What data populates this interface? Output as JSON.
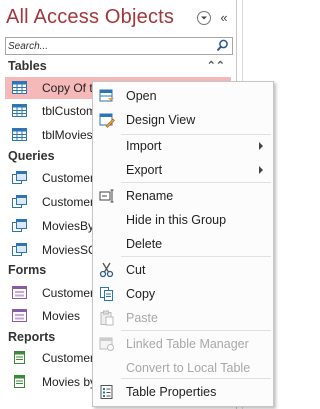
{
  "nav": {
    "title": "All Access Objects",
    "search_placeholder": "Search...",
    "groups": {
      "tables": "Tables",
      "queries": "Queries",
      "forms": "Forms",
      "reports": "Reports"
    },
    "items": {
      "t1": "Copy Of t",
      "t2": "tblCustom",
      "t3": "tblMovies",
      "q1": "Customer",
      "q2": "Customer",
      "q3": "MoviesBy",
      "q4": "MoviesSQ",
      "f1": "Customer",
      "f2": "Movies",
      "r1": "Customer",
      "r2": "Movies by"
    }
  },
  "menu": {
    "open": "Open",
    "design_view": "Design View",
    "import": "Import",
    "export": "Export",
    "rename": "Rename",
    "hide_in_group": "Hide in this Group",
    "delete": "Delete",
    "cut": "Cut",
    "copy": "Copy",
    "paste": "Paste",
    "linked_table_manager": "Linked Table Manager",
    "convert_to_local": "Convert to Local Table",
    "table_properties": "Table Properties"
  },
  "colors": {
    "title": "#a4373a",
    "selected_row": "#f5b9b9",
    "disabled_text": "#a8a8a8"
  }
}
